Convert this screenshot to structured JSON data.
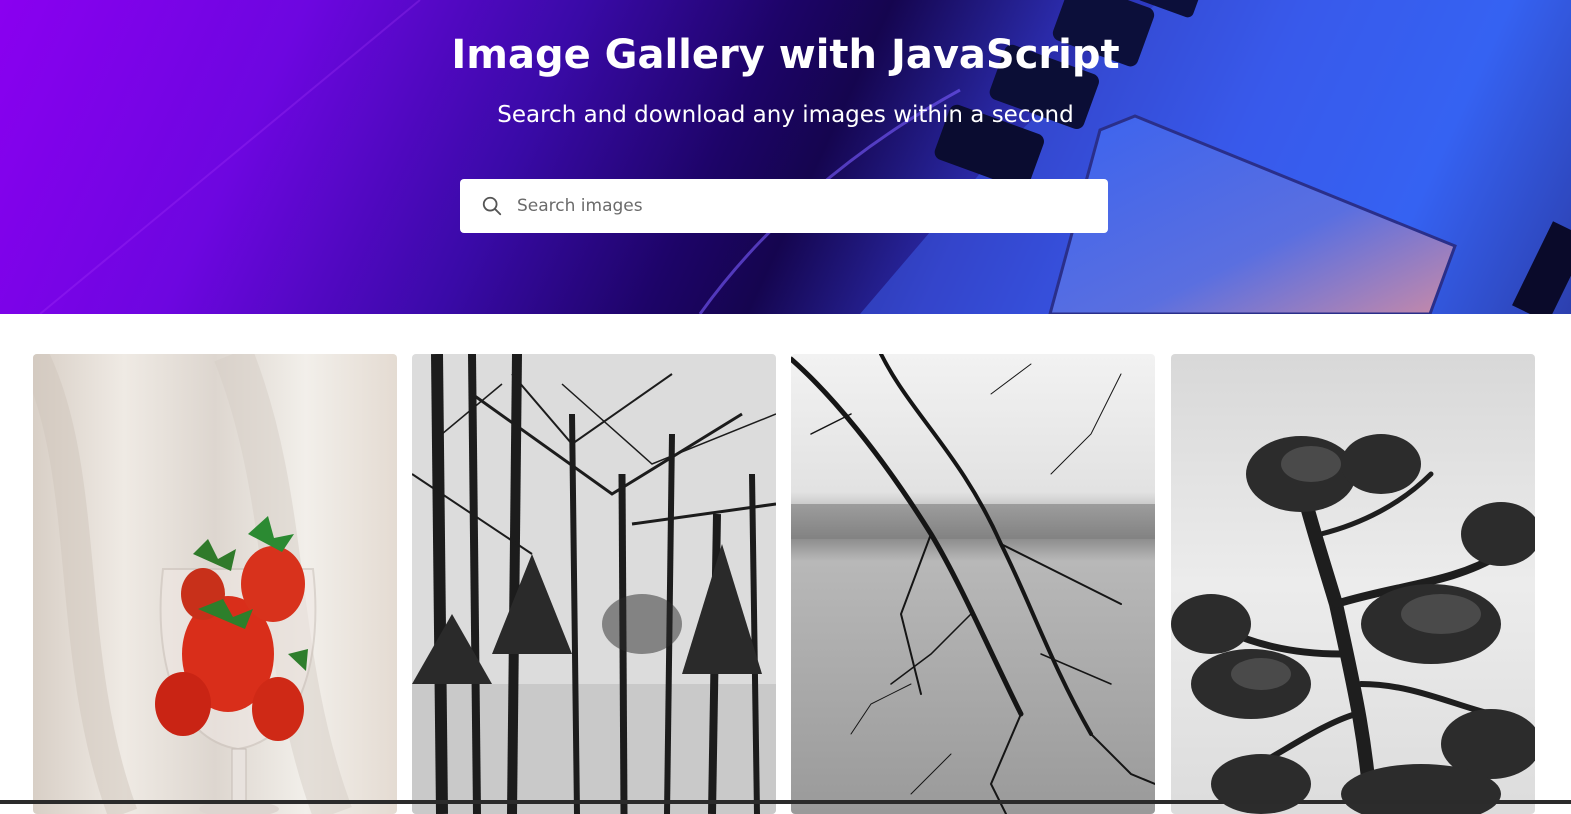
{
  "header": {
    "title": "Image Gallery with JavaScript",
    "subtitle": "Search and download any images within a second"
  },
  "search": {
    "placeholder": "Search images",
    "value": "",
    "icon": "search-icon"
  },
  "gallery": {
    "images": [
      {
        "subject": "strawberries in wine glass"
      },
      {
        "subject": "black and white forest trees"
      },
      {
        "subject": "bare branches over misty lake"
      },
      {
        "subject": "bonsai pine tree silhouette"
      }
    ]
  },
  "colors": {
    "hero_purple": "#8a00f0",
    "hero_navy": "#15054f",
    "hero_blue": "#3458ef"
  }
}
